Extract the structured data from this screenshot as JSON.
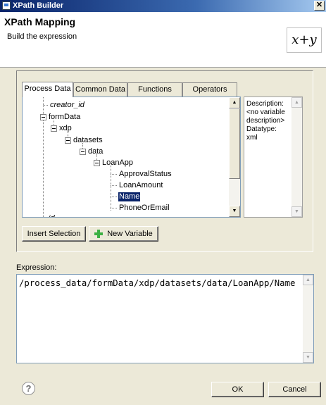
{
  "window": {
    "title": "XPath Builder"
  },
  "header": {
    "title": "XPath Mapping",
    "subtitle": "Build the expression",
    "logo_text": "x+y"
  },
  "tabs": [
    "Process Data",
    "Common Data",
    "Functions",
    "Operators"
  ],
  "tree": {
    "nodes": [
      {
        "label": "creator_id",
        "style": "italic"
      },
      {
        "label": "formData"
      },
      {
        "label": "xdp"
      },
      {
        "label": "datasets"
      },
      {
        "label": "data"
      },
      {
        "label": "LoanApp"
      },
      {
        "label": "ApprovalStatus"
      },
      {
        "label": "LoanAmount"
      },
      {
        "label": "Name",
        "selected": true
      },
      {
        "label": "PhoneOrEmail"
      },
      {
        "label": "id",
        "style": "italic"
      }
    ]
  },
  "description": {
    "line1": "Description:",
    "line2": "<no variable",
    "line3": "description>",
    "line4": "Datatype:",
    "line5": "xml"
  },
  "buttons": {
    "insert_selection": "Insert Selection",
    "new_variable": "New Variable",
    "ok": "OK",
    "cancel": "Cancel"
  },
  "expression": {
    "label": "Expression:",
    "value": "/process_data/formData/xdp/datasets/data/LoanApp/Name"
  },
  "help": {
    "glyph": "?"
  },
  "icons": {
    "close": "✕",
    "scroll_up": "▲",
    "scroll_down": "▼"
  }
}
